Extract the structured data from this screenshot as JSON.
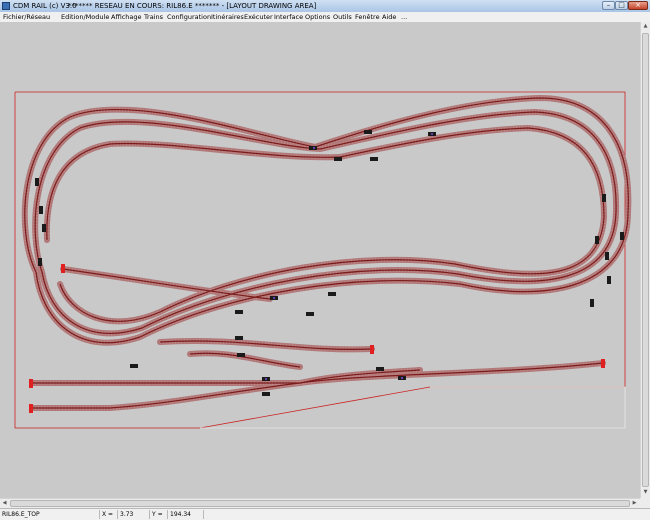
{
  "window": {
    "app_title": "CDM RAIL (c) V3.0",
    "doc_title": "******* RESEAU EN COURS: RIL86.E ******* - [LAYOUT DRAWING AREA]",
    "minimize": "–",
    "maximize": "□",
    "close": "×"
  },
  "menu": [
    "Fichier/Réseau",
    "Edition/Module",
    "Affichage",
    "Trains",
    "Configuration",
    "Itinéraires",
    "Exécuter",
    "Interface",
    "Options",
    "Outils",
    "Fenêtre",
    "Aide",
    "..."
  ],
  "status": {
    "file": "RIL86.E_TOP",
    "x_label": "X =",
    "x_value": "3.73",
    "y_label": "Y =",
    "y_value": "194.34"
  },
  "colors": {
    "canvas": "#c9c9c9",
    "rail": "#7a1c1c",
    "tie": "#c88a8a",
    "border": "#cc2222",
    "bumper": "#e02020",
    "train": "#1a1a1a"
  }
}
